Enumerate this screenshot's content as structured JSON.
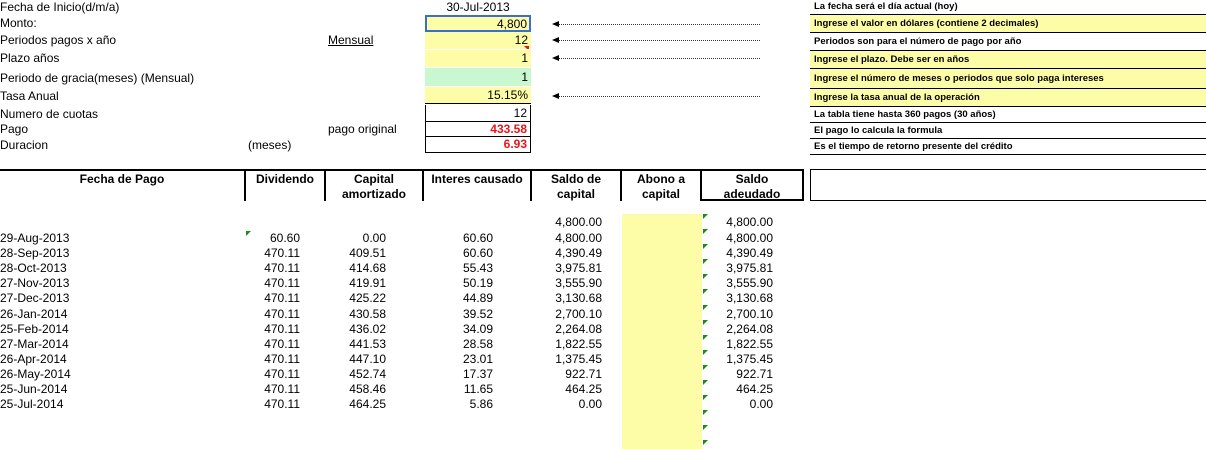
{
  "params": {
    "start_date_label": "Fecha de Inicio(d/m/a)",
    "start_date_value": "30-Jul-2013",
    "amount_label": "Monto:",
    "amount_value": "4,800",
    "periods_label": "Periodos pagos x año",
    "periods_mode": "Mensual",
    "periods_value": "12",
    "term_label": "Plazo años",
    "term_value": "1",
    "grace_label": "Periodo de gracia(meses) (Mensual)",
    "grace_value": "1",
    "rate_label": "Tasa Anual",
    "rate_value": "15.15%",
    "installments_label": "Numero de cuotas",
    "installments_value": "12",
    "payment_label": "Pago",
    "payment_sublabel": "pago original",
    "payment_value": "433.58",
    "duration_label": "Duracion",
    "duration_unit": "(meses)",
    "duration_value": "6.93"
  },
  "notes": [
    "La fecha será el día actual (hoy)",
    "Ingrese el valor en dólares (contiene 2 decimales)",
    "Periodos son para el número de pago por año",
    "Ingrese el plazo. Debe ser en años",
    "Ingrese el número de meses o periodos que solo paga intereses",
    "Ingrese la tasa  anual de la operación",
    "La tabla tiene hasta 360 pagos (30 años)",
    "El pago lo calcula la formula",
    "Es el tiempo de retorno presente del crédito"
  ],
  "table": {
    "headers": {
      "fecha": "Fecha de Pago",
      "dividendo": "Dividendo",
      "capital_1": "Capital",
      "capital_2": "amortizado",
      "interes": "Interes causado",
      "saldo_cap_1": "Saldo de",
      "saldo_cap_2": "capital",
      "abono_1": "Abono a",
      "abono_2": "capital",
      "saldo_ad_1": "Saldo",
      "saldo_ad_2": "adeudado"
    },
    "initial_saldo_capital": "4,800.00",
    "initial_saldo_adeudado": "4,800.00",
    "rows": [
      {
        "fecha": "29-Aug-2013",
        "dividendo": "60.60",
        "capital": "0.00",
        "interes": "60.60",
        "saldo_capital": "4,800.00",
        "saldo_adeudado": "4,800.00"
      },
      {
        "fecha": "28-Sep-2013",
        "dividendo": "470.11",
        "capital": "409.51",
        "interes": "60.60",
        "saldo_capital": "4,390.49",
        "saldo_adeudado": "4,390.49"
      },
      {
        "fecha": "28-Oct-2013",
        "dividendo": "470.11",
        "capital": "414.68",
        "interes": "55.43",
        "saldo_capital": "3,975.81",
        "saldo_adeudado": "3,975.81"
      },
      {
        "fecha": "27-Nov-2013",
        "dividendo": "470.11",
        "capital": "419.91",
        "interes": "50.19",
        "saldo_capital": "3,555.90",
        "saldo_adeudado": "3,555.90"
      },
      {
        "fecha": "27-Dec-2013",
        "dividendo": "470.11",
        "capital": "425.22",
        "interes": "44.89",
        "saldo_capital": "3,130.68",
        "saldo_adeudado": "3,130.68"
      },
      {
        "fecha": "26-Jan-2014",
        "dividendo": "470.11",
        "capital": "430.58",
        "interes": "39.52",
        "saldo_capital": "2,700.10",
        "saldo_adeudado": "2,700.10"
      },
      {
        "fecha": "25-Feb-2014",
        "dividendo": "470.11",
        "capital": "436.02",
        "interes": "34.09",
        "saldo_capital": "2,264.08",
        "saldo_adeudado": "2,264.08"
      },
      {
        "fecha": "27-Mar-2014",
        "dividendo": "470.11",
        "capital": "441.53",
        "interes": "28.58",
        "saldo_capital": "1,822.55",
        "saldo_adeudado": "1,822.55"
      },
      {
        "fecha": "26-Apr-2014",
        "dividendo": "470.11",
        "capital": "447.10",
        "interes": "23.01",
        "saldo_capital": "1,375.45",
        "saldo_adeudado": "1,375.45"
      },
      {
        "fecha": "26-May-2014",
        "dividendo": "470.11",
        "capital": "452.74",
        "interes": "17.37",
        "saldo_capital": "922.71",
        "saldo_adeudado": "922.71"
      },
      {
        "fecha": "25-Jun-2014",
        "dividendo": "470.11",
        "capital": "458.46",
        "interes": "11.65",
        "saldo_capital": "464.25",
        "saldo_adeudado": "464.25"
      },
      {
        "fecha": "25-Jul-2014",
        "dividendo": "470.11",
        "capital": "464.25",
        "interes": "5.86",
        "saldo_capital": "0.00",
        "saldo_adeudado": "0.00"
      }
    ]
  },
  "colors": {
    "input_yellow": "#fdfca7",
    "grace_green": "#c9f7cf",
    "result_red": "#e8141c",
    "comment_marker_green": "#1a8a1a"
  }
}
